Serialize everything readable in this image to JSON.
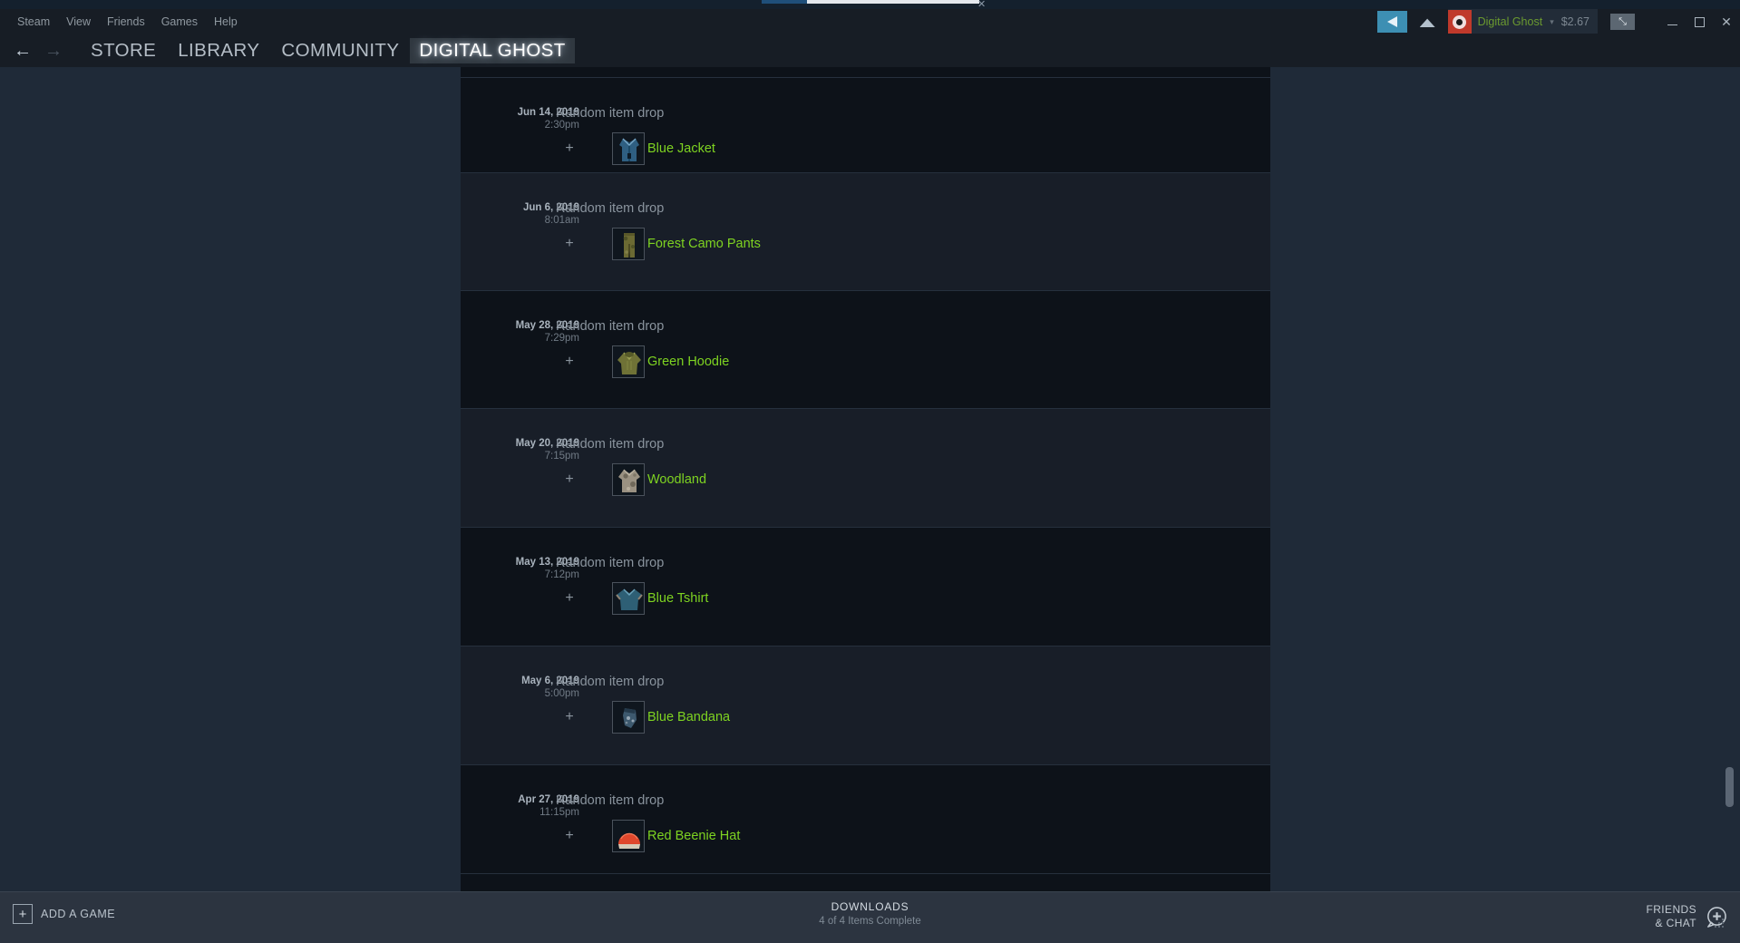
{
  "app": {
    "title": "Steam",
    "accent_green": "#7ed321",
    "panel_bg": "#0d1219",
    "alt_row_bg": "#181e28"
  },
  "menubar": {
    "items": [
      {
        "label": "Steam",
        "name": "menu-steam"
      },
      {
        "label": "View",
        "name": "menu-view"
      },
      {
        "label": "Friends",
        "name": "menu-friends"
      },
      {
        "label": "Games",
        "name": "menu-games"
      },
      {
        "label": "Help",
        "name": "menu-help"
      }
    ]
  },
  "account": {
    "broadcast_icon": "broadcast-icon",
    "mail_icon": "envelope-icon",
    "avatar_icon": "avatar-eye-icon",
    "username": "Digital Ghost",
    "caret": "▾",
    "wallet": "$2.67",
    "expand_icon": "⤡",
    "minimize_label": "",
    "maximize_label": "",
    "close_label": "✕"
  },
  "nav": {
    "back_icon": "←",
    "forward_icon": "→",
    "tabs": [
      {
        "label": "STORE",
        "name": "nav-tab-store",
        "active": false
      },
      {
        "label": "LIBRARY",
        "name": "nav-tab-library",
        "active": false
      },
      {
        "label": "COMMUNITY",
        "name": "nav-tab-community",
        "active": false
      },
      {
        "label": "DIGITAL GHOST",
        "name": "nav-tab-digital-ghost",
        "active": true
      }
    ]
  },
  "inventory_history": {
    "rows": [
      {
        "date": "Jun 14, 2019",
        "time": "2:30pm",
        "title": "Random item drop",
        "plus": "+",
        "item_name": "Blue Jacket",
        "item_icon": "blue-jacket-icon"
      },
      {
        "date": "Jun 6, 2019",
        "time": "8:01am",
        "title": "Random item drop",
        "plus": "+",
        "item_name": "Forest Camo Pants",
        "item_icon": "forest-camo-pants-icon"
      },
      {
        "date": "May 28, 2019",
        "time": "7:29pm",
        "title": "Random item drop",
        "plus": "+",
        "item_name": "Green Hoodie",
        "item_icon": "green-hoodie-icon"
      },
      {
        "date": "May 20, 2019",
        "time": "7:15pm",
        "title": "Random item drop",
        "plus": "+",
        "item_name": "Woodland",
        "item_icon": "woodland-icon"
      },
      {
        "date": "May 13, 2019",
        "time": "7:12pm",
        "title": "Random item drop",
        "plus": "+",
        "item_name": "Blue Tshirt",
        "item_icon": "blue-tshirt-icon"
      },
      {
        "date": "May 6, 2019",
        "time": "5:00pm",
        "title": "Random item drop",
        "plus": "+",
        "item_name": "Blue Bandana",
        "item_icon": "blue-bandana-icon"
      },
      {
        "date": "Apr 27, 2019",
        "time": "11:15pm",
        "title": "Random item drop",
        "plus": "+",
        "item_name": "Red Beenie Hat",
        "item_icon": "red-beenie-hat-icon"
      }
    ]
  },
  "footer": {
    "add_game_plus": "+",
    "add_game_label": "ADD A GAME",
    "downloads_title": "DOWNLOADS",
    "downloads_status": "4 of 4 Items Complete",
    "friends_line1": "FRIENDS",
    "friends_line2": "& CHAT",
    "friends_icon": "chat-bubble-plus-icon"
  }
}
